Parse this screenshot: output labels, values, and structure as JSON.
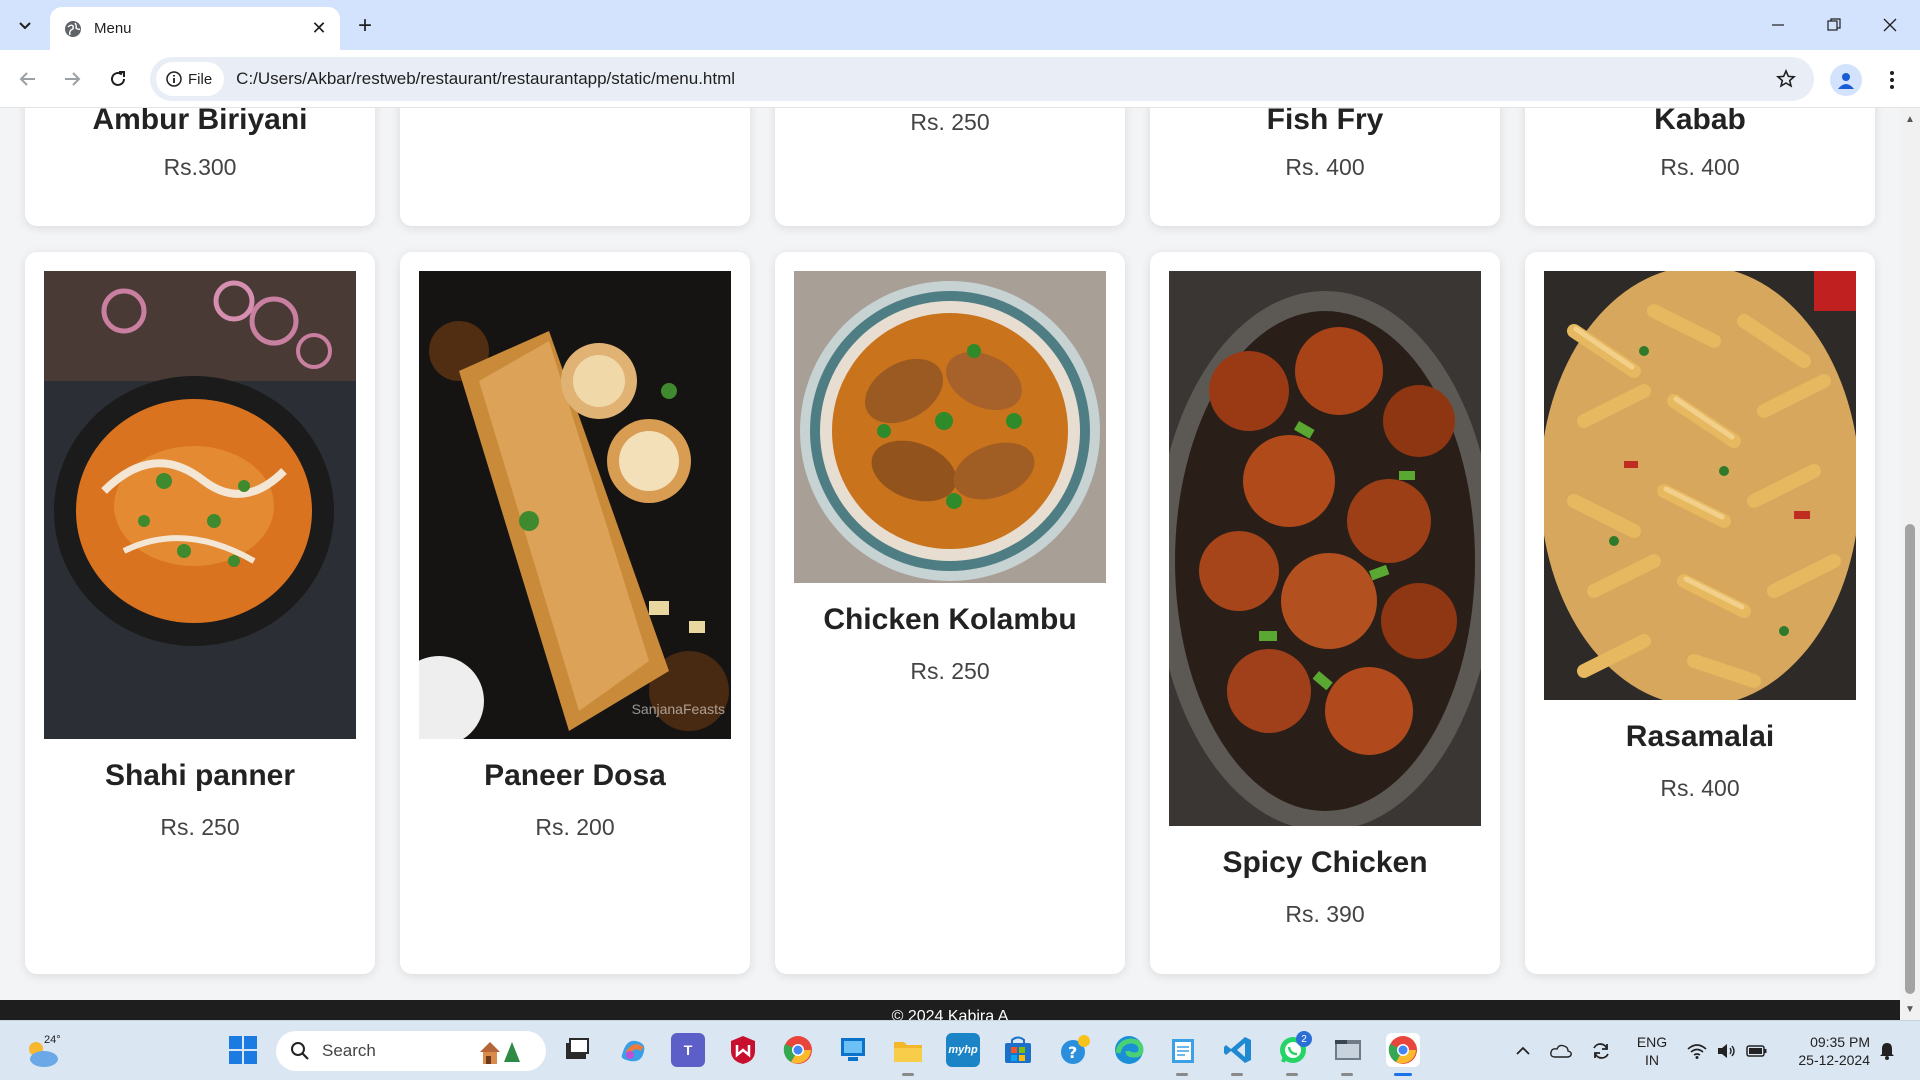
{
  "browser": {
    "tab_title": "Menu",
    "file_chip": "File",
    "url": "C:/Users/Akbar/restweb/restaurant/restaurantapp/static/menu.html"
  },
  "menu": {
    "top_row": [
      {
        "name": "Ambur Biriyani",
        "price": "Rs.300"
      },
      {
        "name": "",
        "price": ""
      },
      {
        "name": "",
        "price": "Rs. 250"
      },
      {
        "name": "Fish Fry",
        "price": "Rs. 400"
      },
      {
        "name": "Kabab",
        "price": "Rs. 400"
      }
    ],
    "items": [
      {
        "name": "Shahi panner",
        "price": "Rs. 250",
        "image": "curry-bowl-image"
      },
      {
        "name": "Paneer Dosa",
        "price": "Rs. 200",
        "image": "dosa-image"
      },
      {
        "name": "Chicken Kolambu",
        "price": "Rs. 250",
        "image": "chicken-curry-image"
      },
      {
        "name": "Spicy Chicken",
        "price": "Rs. 390",
        "image": "spicy-chicken-image"
      },
      {
        "name": "Rasamalai",
        "price": "Rs. 400",
        "image": "pasta-image"
      }
    ],
    "image_watermark": "SanjanaFeasts"
  },
  "footer": {
    "text": "© 2024 Kabira A"
  },
  "taskbar": {
    "weather_temp": "24°",
    "search_placeholder": "Search",
    "whatsapp_badge": "2",
    "lang_line1": "ENG",
    "lang_line2": "IN",
    "time": "09:35 PM",
    "date": "25-12-2024",
    "hp_label": "myhp"
  }
}
